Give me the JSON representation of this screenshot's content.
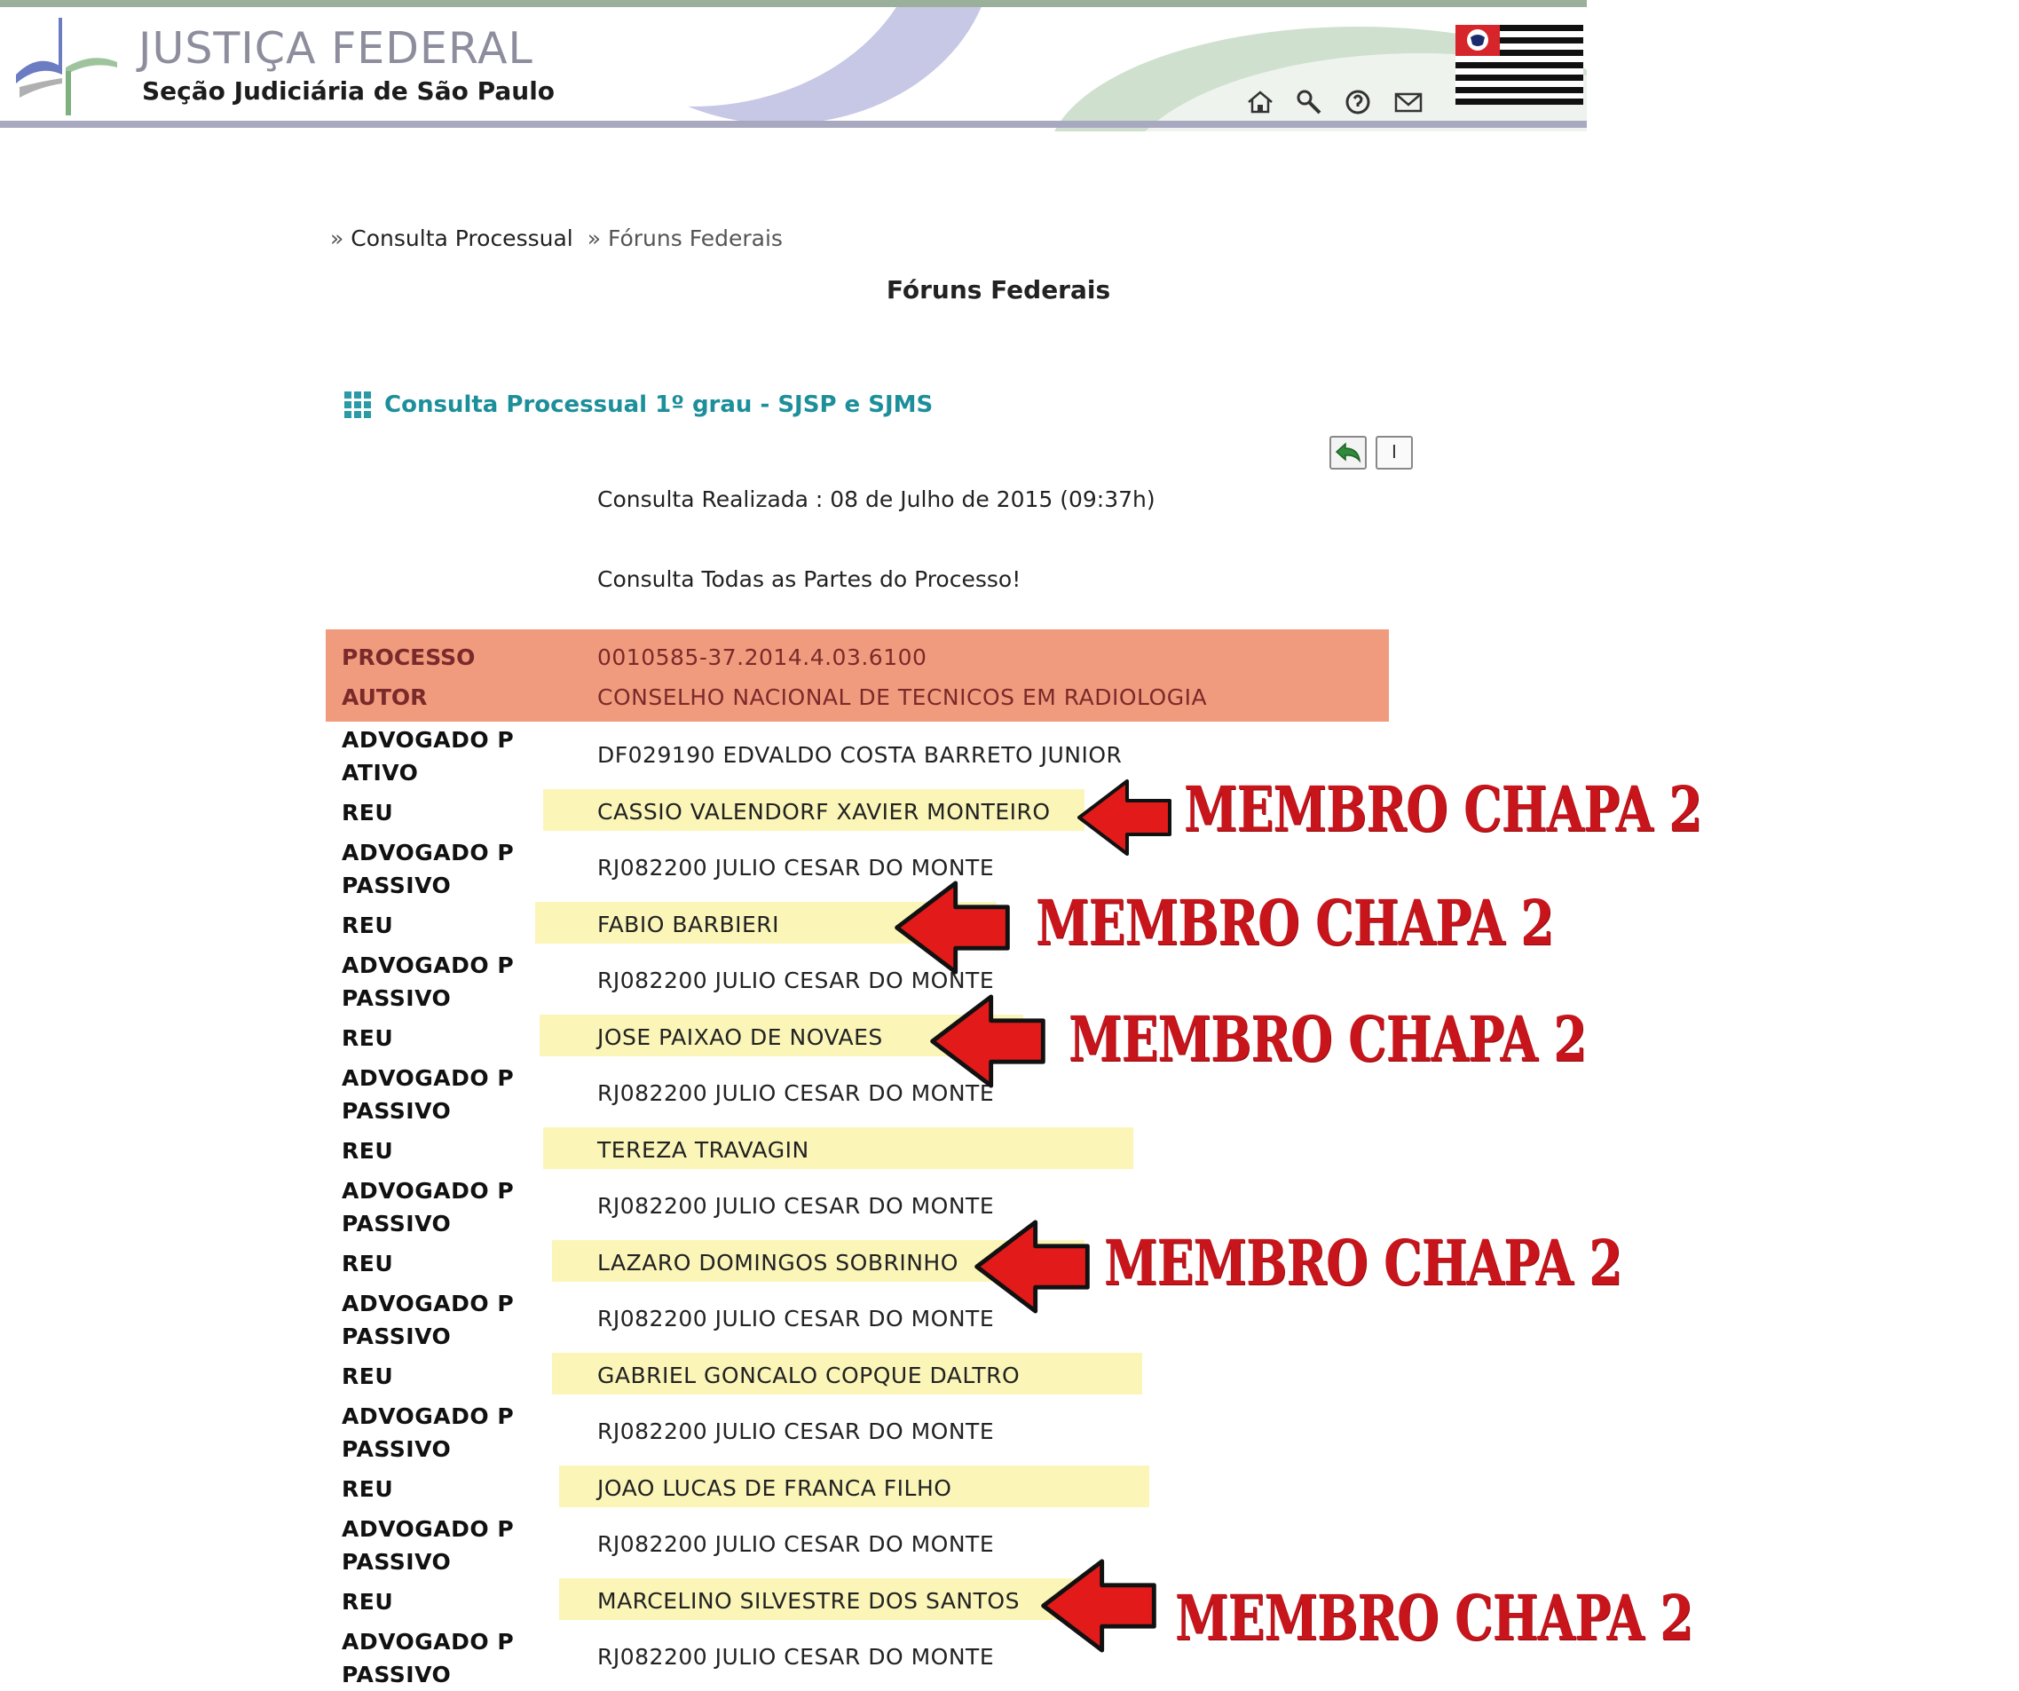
{
  "header": {
    "site_title": "JUSTIÇA FEDERAL",
    "site_subtitle": "Seção Judiciária de São Paulo",
    "icons": [
      "home-icon",
      "search-icon",
      "help-icon",
      "mail-icon"
    ]
  },
  "breadcrumb": {
    "items": [
      "Consulta Processual",
      "Fóruns Federais"
    ]
  },
  "page_title": "Fóruns Federais",
  "section_heading": "Consulta Processual 1º grau - SJSP e SJMS",
  "toolbar": {
    "print_label": "I"
  },
  "consulta": {
    "date_line": "Consulta Realizada : 08 de Julho de 2015 (09:37h)",
    "note_line": "Consulta Todas as Partes do Processo!"
  },
  "processo": {
    "processo_label": "PROCESSO",
    "processo_value": "0010585-37.2014.4.03.6100",
    "autor_label": "AUTOR",
    "autor_value": "CONSELHO NACIONAL DE TECNICOS EM RADIOLOGIA"
  },
  "rows": [
    {
      "label_1": "ADVOGADO P",
      "label_2": "ATIVO",
      "value": "DF029190 EDVALDO COSTA BARRETO JUNIOR"
    },
    {
      "label_1": "REU",
      "value": "CASSIO VALENDORF XAVIER MONTEIRO"
    },
    {
      "label_1": "ADVOGADO P",
      "label_2": "PASSIVO",
      "value": "RJ082200 JULIO CESAR DO MONTE"
    },
    {
      "label_1": "REU",
      "value": "FABIO BARBIERI"
    },
    {
      "label_1": "ADVOGADO P",
      "label_2": "PASSIVO",
      "value": "RJ082200 JULIO CESAR DO MONTE"
    },
    {
      "label_1": "REU",
      "value": "JOSE PAIXAO DE NOVAES"
    },
    {
      "label_1": "ADVOGADO P",
      "label_2": "PASSIVO",
      "value": "RJ082200 JULIO CESAR DO MONTE"
    },
    {
      "label_1": "REU",
      "value": "TEREZA TRAVAGIN"
    },
    {
      "label_1": "ADVOGADO P",
      "label_2": "PASSIVO",
      "value": "RJ082200 JULIO CESAR DO MONTE"
    },
    {
      "label_1": "REU",
      "value": "LAZARO DOMINGOS SOBRINHO"
    },
    {
      "label_1": "ADVOGADO P",
      "label_2": "PASSIVO",
      "value": "RJ082200 JULIO CESAR DO MONTE"
    },
    {
      "label_1": "REU",
      "value": "GABRIEL GONCALO COPQUE DALTRO"
    },
    {
      "label_1": "ADVOGADO P",
      "label_2": "PASSIVO",
      "value": "RJ082200 JULIO CESAR DO MONTE"
    },
    {
      "label_1": "REU",
      "value": "JOAO LUCAS DE FRANCA FILHO"
    },
    {
      "label_1": "ADVOGADO P",
      "label_2": "PASSIVO",
      "value": "RJ082200 JULIO CESAR DO MONTE"
    },
    {
      "label_1": "REU",
      "value": "MARCELINO SILVESTRE DOS SANTOS"
    },
    {
      "label_1": "ADVOGADO P",
      "label_2": "PASSIVO",
      "value": "RJ082200 JULIO CESAR DO MONTE"
    }
  ],
  "annotations": [
    {
      "text": "MEMBRO CHAPA 2"
    },
    {
      "text": "MEMBRO CHAPA 2"
    },
    {
      "text": "MEMBRO CHAPA 2"
    },
    {
      "text": "MEMBRO CHAPA 2"
    },
    {
      "text": "MEMBRO CHAPA 2"
    }
  ],
  "colors": {
    "process_header_bg": "#f19b7e",
    "reu_highlight": "#fbf6b8",
    "section_heading": "#1d8f9a",
    "annotation_red": "#c8141b"
  }
}
